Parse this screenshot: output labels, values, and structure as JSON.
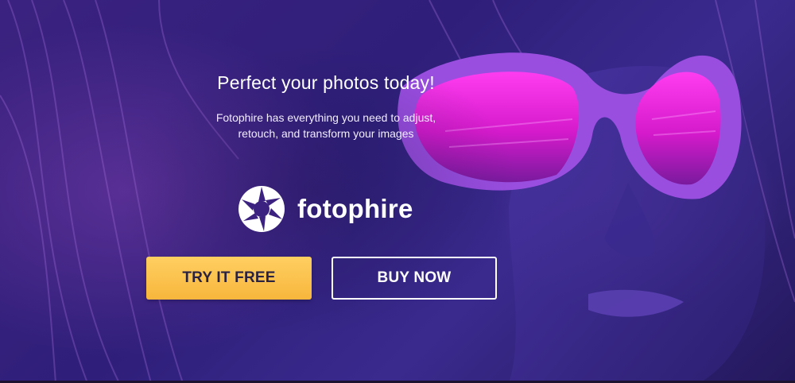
{
  "hero": {
    "headline": "Perfect your photos today!",
    "subtext_line1": "Fotophire has everything you need to adjust,",
    "subtext_line2": "retouch, and transform your images"
  },
  "brand": {
    "logo_icon": "camera-shutter-icon",
    "name": "fotophire"
  },
  "buttons": {
    "try_label": "TRY IT FREE",
    "buy_label": "BUY NOW"
  },
  "colors": {
    "background": "#3b2280",
    "lens": "#e01bd6",
    "frame": "#9a4ee0",
    "try_button": "#f7b63c",
    "buy_button_border": "#ffffff"
  }
}
